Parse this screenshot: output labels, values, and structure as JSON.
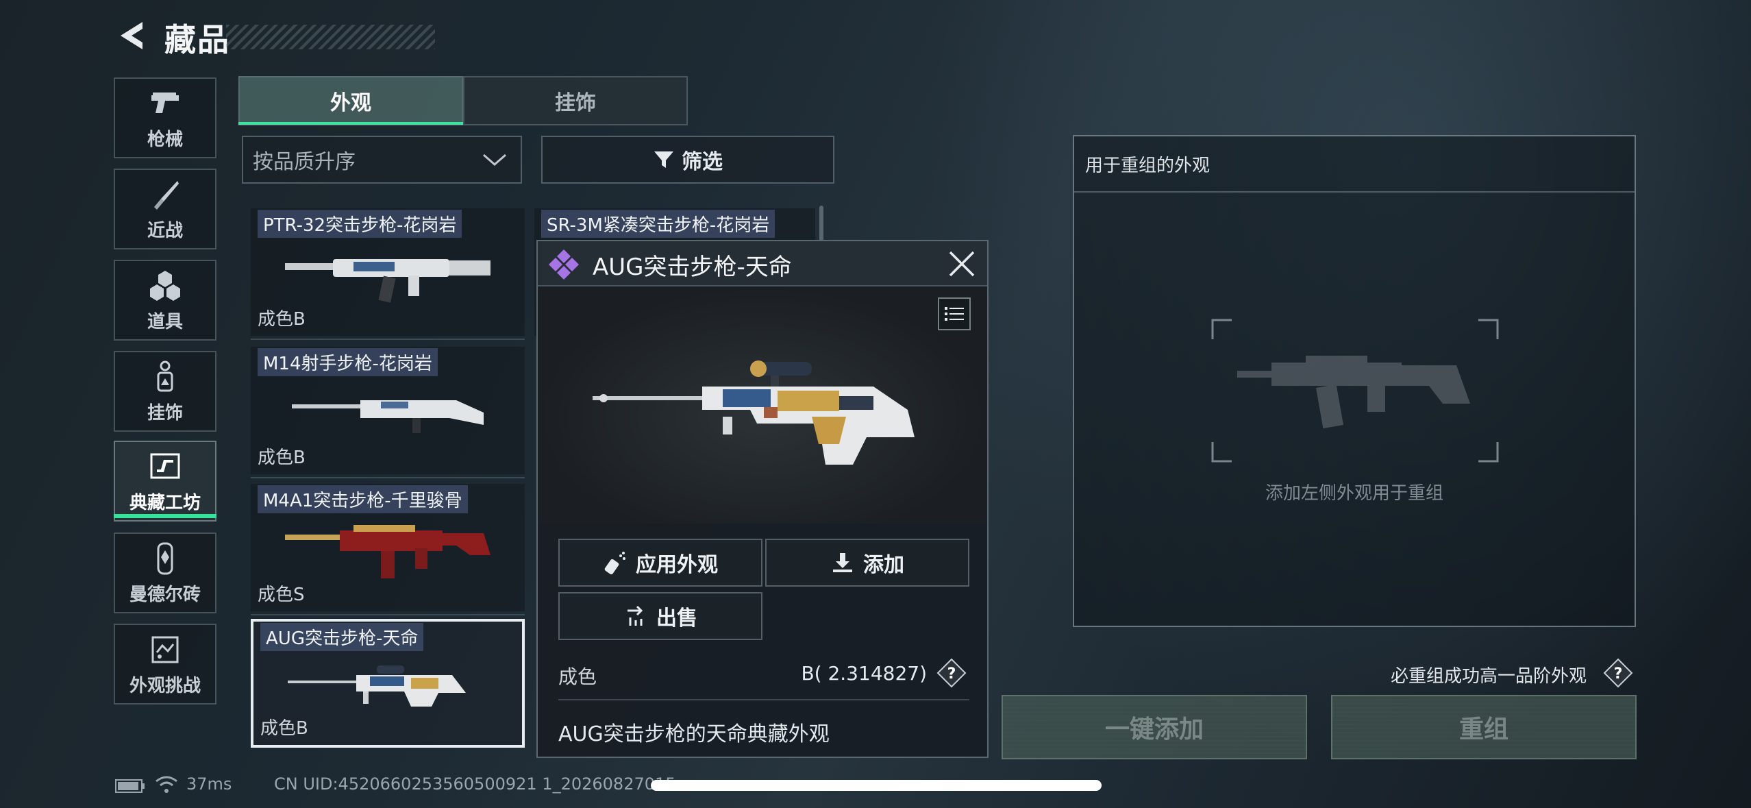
{
  "header": {
    "title": "藏品"
  },
  "sidebar": {
    "items": [
      {
        "label": "枪械",
        "icon": "pistol-icon"
      },
      {
        "label": "近战",
        "icon": "knife-icon"
      },
      {
        "label": "道具",
        "icon": "grenade-icon"
      },
      {
        "label": "挂饰",
        "icon": "charm-icon"
      },
      {
        "label": "典藏工坊",
        "icon": "workshop-icon",
        "active": true
      },
      {
        "label": "曼德尔砖",
        "icon": "brick-icon"
      },
      {
        "label": "外观挑战",
        "icon": "challenge-icon"
      }
    ]
  },
  "tabs": [
    {
      "label": "外观",
      "active": true
    },
    {
      "label": "挂饰",
      "active": false
    }
  ],
  "sort": {
    "value": "按品质升序"
  },
  "filter": {
    "label": "筛选"
  },
  "skins": [
    {
      "name": "PTR-32突击步枪-花岗岩",
      "wear": "成色B"
    },
    {
      "name": "SR-3M紧凑突击步枪-花岗岩",
      "wear": ""
    },
    {
      "name": "M14射手步枪-花岗岩",
      "wear": "成色B"
    },
    {
      "name": "M4A1突击步枪-千里骏骨",
      "wear": "成色S"
    },
    {
      "name": "AUG突击步枪-天命",
      "wear": "成色B",
      "selected": true
    }
  ],
  "popup": {
    "title": "AUG突击步枪-天命",
    "apply_label": "应用外观",
    "add_label": "添加",
    "sell_label": "出售",
    "wear_key": "成色",
    "wear_value": "B( 2.314827)",
    "description": "AUG突击步枪的天命典藏外观",
    "rarity_color": "#a774e6"
  },
  "recombine": {
    "header": "用于重组的外观",
    "empty_hint": "添加左侧外观用于重组",
    "guarantee": "必重组成功高一品阶外观",
    "quick_add_label": "一键添加",
    "recombine_label": "重组"
  },
  "footer": {
    "ping": "37ms",
    "uid": "CN UID:4520660253560500921 1_20260827015"
  },
  "colors": {
    "accent": "#3ee3a0"
  }
}
